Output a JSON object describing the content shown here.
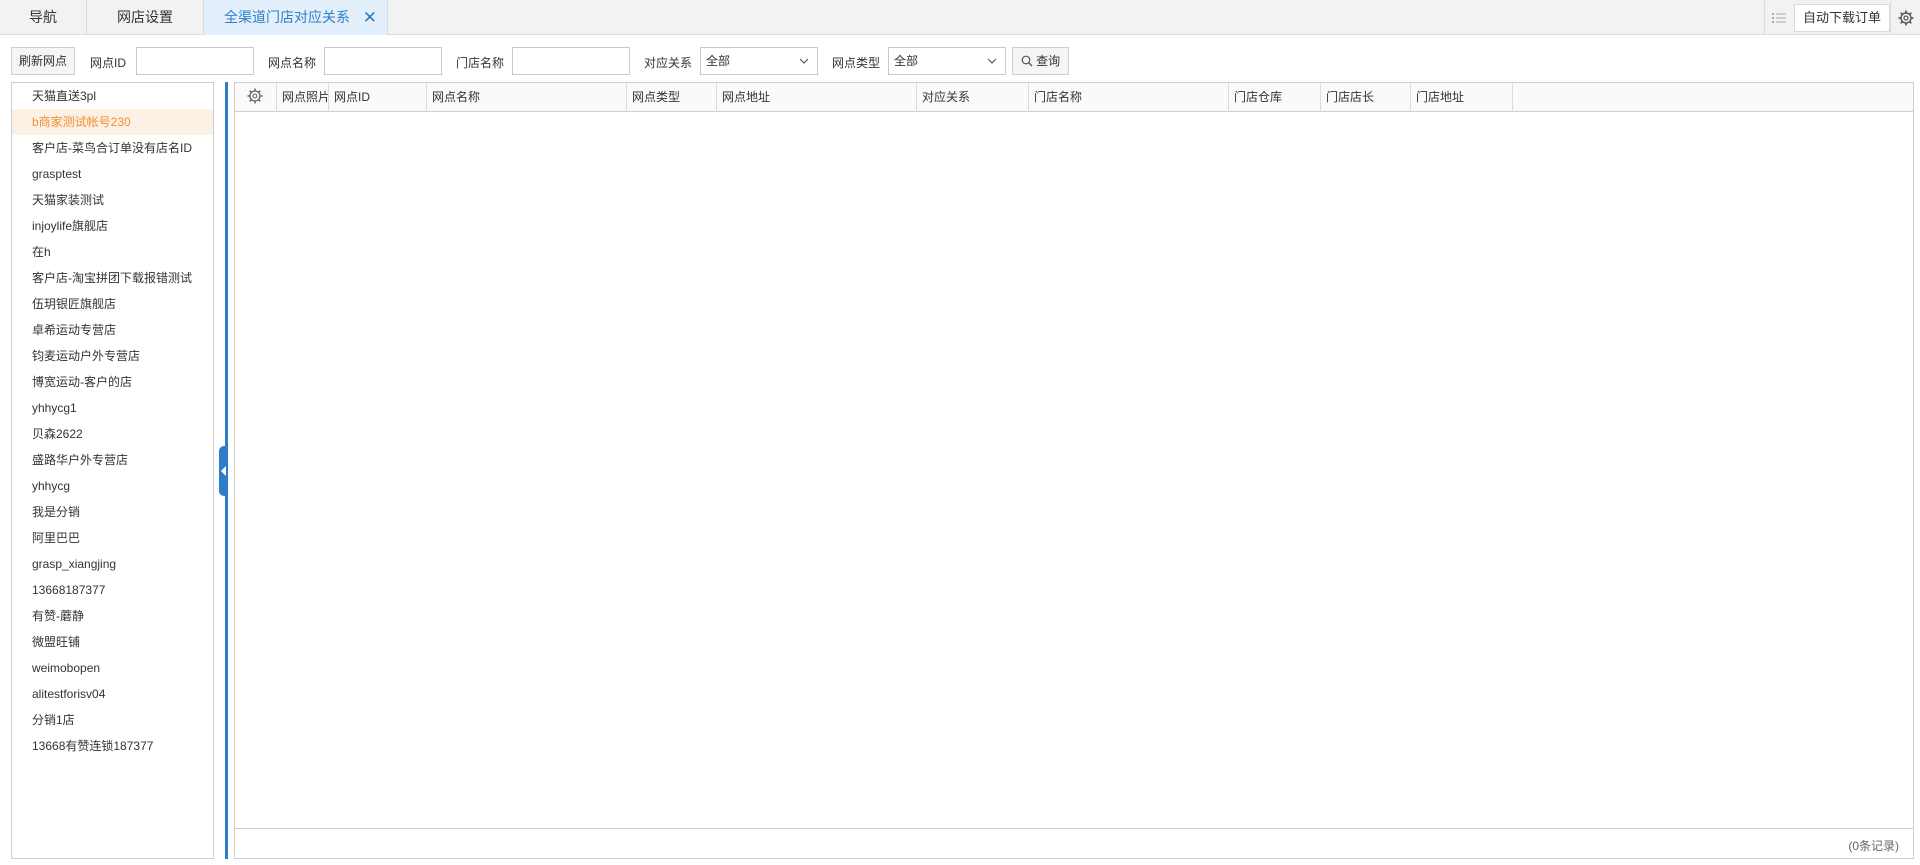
{
  "tabs": {
    "nav": "导航",
    "shop_settings": "网店设置",
    "active": "全渠道门店对应关系",
    "close_glyph": "✕"
  },
  "toolbar": {
    "auto_download": "自动下载订单",
    "list_icon": "list-icon",
    "gear_icon": "gear-icon"
  },
  "filter": {
    "refresh_button": "刷新网点",
    "shop_id_label": "网点ID",
    "shop_id_value": "",
    "shop_name_label": "网点名称",
    "shop_name_value": "",
    "store_name_label": "门店名称",
    "store_name_value": "",
    "relation_label": "对应关系",
    "relation_value": "全部",
    "shop_type_label": "网点类型",
    "shop_type_value": "全部",
    "query_button": "查询"
  },
  "sidebar": {
    "items": [
      "天猫直送3pl",
      "b商家测试帐号230",
      "客户店-菜鸟合订单没有店名ID",
      "grasptest",
      "天猫家装测试",
      "injoylife旗舰店",
      "在h",
      "客户店-淘宝拼团下载报错测试",
      "伍玥银匠旗舰店",
      "卓希运动专营店",
      "钧麦运动户外专营店",
      "博宽运动-客户的店",
      "yhhycg1",
      "贝森2622",
      "盛路华户外专营店",
      "yhhycg",
      "我是分销",
      "阿里巴巴",
      "grasp_xiangjing",
      "13668187377",
      "有赞-蘑静",
      "微盟旺铺",
      "weimobopen",
      "alitestforisv04",
      "分销1店",
      "13668有赞连锁187377"
    ],
    "active_index": 1
  },
  "grid": {
    "columns": [
      "网点照片",
      "网点ID",
      "网点名称",
      "网点类型",
      "网点地址",
      "对应关系",
      "门店名称",
      "门店仓库",
      "门店店长",
      "门店地址"
    ],
    "rows": [],
    "record_count": "(0条记录)"
  },
  "colors": {
    "accent": "#2d7ec8",
    "active_item": "#f08f2e",
    "active_item_bg": "#fdf1e5"
  }
}
